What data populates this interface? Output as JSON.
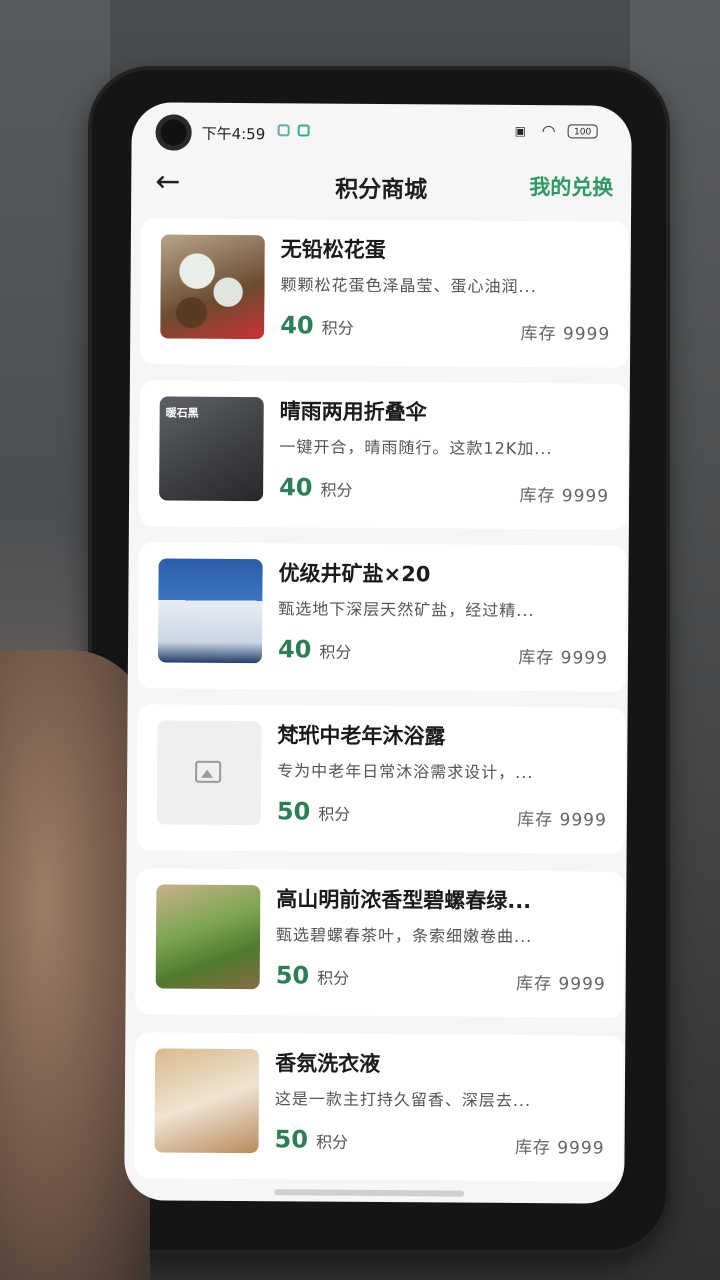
{
  "status_bar": {
    "time": "下午4:59",
    "battery": "100"
  },
  "header": {
    "back_icon": "arrow-left-icon",
    "title": "积分商城",
    "my_exchange": "我的兑换"
  },
  "products": [
    {
      "name": "无铅松花蛋",
      "desc": "颗颗松花蛋色泽晶莹、蛋心油润...",
      "points": "40",
      "points_unit": "积分",
      "stock": "库存 9999"
    },
    {
      "name": "晴雨两用折叠伞",
      "desc": "一键开合，晴雨随行。这款12K加...",
      "points": "40",
      "points_unit": "积分",
      "stock": "库存 9999",
      "thumb_text": "暖石黑"
    },
    {
      "name": "优级井矿盐×20",
      "desc": "甄选地下深层天然矿盐，经过精...",
      "points": "40",
      "points_unit": "积分",
      "stock": "库存 9999"
    },
    {
      "name": "梵玳中老年沐浴露",
      "desc": "专为中老年日常沐浴需求设计，...",
      "points": "50",
      "points_unit": "积分",
      "stock": "库存 9999"
    },
    {
      "name": "高山明前浓香型碧螺春绿...",
      "desc": "甄选碧螺春茶叶，条索细嫩卷曲...",
      "points": "50",
      "points_unit": "积分",
      "stock": "库存 9999"
    },
    {
      "name": "香氛洗衣液",
      "desc": "这是一款主打持久留香、深层去...",
      "points": "50",
      "points_unit": "积分",
      "stock": "库存 9999"
    }
  ],
  "colors": {
    "accent": "#2e9a63",
    "points": "#2b7f55"
  }
}
